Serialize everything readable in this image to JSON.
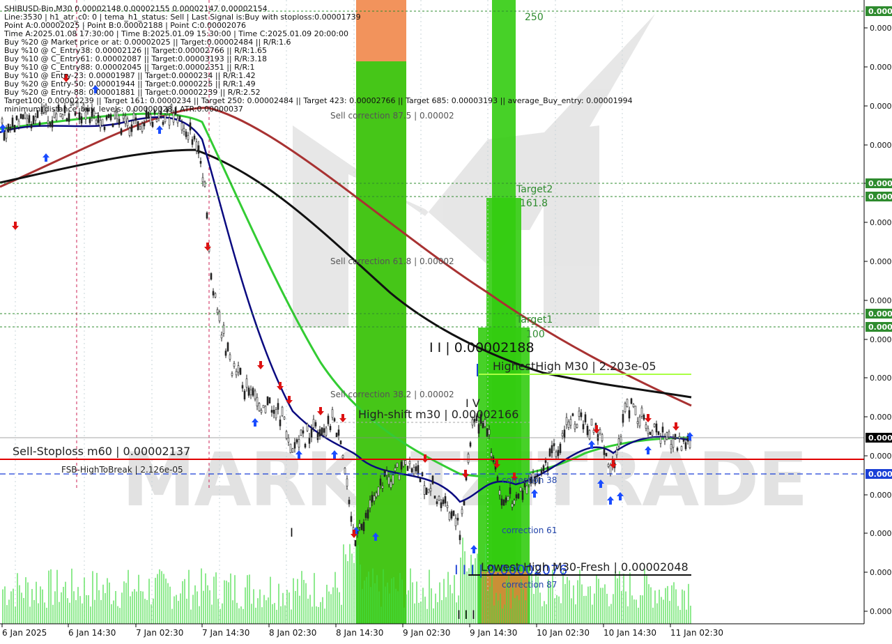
{
  "chart_data": {
    "type": "candlestick",
    "symbol_line": "SHIBUSD-Bin,M30  0.00002148 0.00002155 0.00002147 0.00002154",
    "info_lines": [
      "Line:3530 | h1_atr_c0: 0 | tema_h1_status: Sell | Last Signal is:Buy with stoploss:0.00001739",
      "Point A:0.00002025 | Point B:0.00002188 | Point C:0.00002076",
      "Time A:2025.01.08 17:30:00 | Time B:2025.01.09 15:30:00 | Time C:2025.01.09 20:00:00",
      "Buy %20 @ Market price or at: 0.00002025 || Target:0.00002484 || R/R:1.6",
      "Buy %10 @ C_Entry38: 0.00002126 || Target:0.00002766 || R/R:1.65",
      "Buy %10 @ C_Entry61: 0.00002087 || Target:0.00003193 || R/R:3.18",
      "Buy %10 @ C_Entry88: 0.00002045 || Target:0.00002351 || R/R:1",
      "Buy %10 @ Entry-23: 0.00001987 || Target:0.0000234 || R/R:1.42",
      "Buy %20 @ Entry-50: 0.00001944 || Target:0.0000225 || R/R:1.49",
      "Buy %20 @ Entry-88: 0.00001881 || Target:0.00002239 || R/R:2.52",
      "Target100: 0.00002239 || Target 161: 0.0000234 || Target 250: 0.00002484 || Target 423: 0.00002766 || Target 685: 0.00003193 || average_Buy_entry: 0.00001994",
      "minimum_distance_buy_levels: 0.00000028 | ATR:0.00000037"
    ],
    "x_tick_labels": [
      "6 Jan 2025",
      "6 Jan 14:30",
      "7 Jan 02:30",
      "7 Jan 14:30",
      "8 Jan 02:30",
      "8 Jan 14:30",
      "9 Jan 02:30",
      "9 Jan 14:30",
      "10 Jan 02:30",
      "10 Jan 14:30",
      "11 Jan 02:30"
    ],
    "y_tick_labels": [
      "0.0000",
      "0.0000",
      "0.0000",
      "0.0000",
      "0.0000",
      "0.0000",
      "0.0000",
      "0.0000",
      "0.0000",
      "0.0000",
      "0.0000",
      "0.0000",
      "0.0000",
      "0.0000",
      "0.0000",
      "0.0000"
    ],
    "price_tags": [
      {
        "label": "0.0000",
        "color": "#2e8b2e"
      },
      {
        "label": "0.0000",
        "color": "#2e8b2e"
      },
      {
        "label": "0.0000",
        "color": "#2e8b2e"
      },
      {
        "label": "0.0000",
        "color": "#2e8b2e"
      },
      {
        "label": "0.0000",
        "color": "#2e8b2e"
      },
      {
        "label": "0.0000",
        "color": "#000000"
      },
      {
        "label": "0.0000",
        "color": "#1a3fd6"
      }
    ],
    "annotations": {
      "fib_250": "250",
      "target2": "Target2",
      "fib_161": "161.8",
      "target1": "Target1",
      "fib_100": "100",
      "sell_corr_875": "Sell correction 87.5 | 0.00002",
      "sell_corr_618": "Sell correction 61.8 | 0.00002",
      "sell_corr_382": "Sell correction 38.2 | 0.00002",
      "point_b": "I I | 0.00002188",
      "highest_high": "HighestHigh   M30 | 2.203e-05",
      "iv_label": "I V",
      "high_shift": "High-shift m30 | 0.00002166",
      "sell_stoploss": "Sell-Stoploss m60 | 0.00002137",
      "fsb": "FSB-HighToBreak | 2.126e-05",
      "correction_38": "correction 38",
      "correction_61": "correction 61",
      "correction_87": "correction 87",
      "point_c": "I I I | 0.00002076",
      "lowest_high": "0.00002076",
      "lowest_fresh": "Lowest High   M30-Fresh | 0.00002048",
      "point_a": "I I I",
      "i_mark": "I",
      "watermark": "MARKETZITRADE"
    },
    "colors": {
      "ema_red": "#a83232",
      "ema_black": "#111111",
      "ema_green": "#33cc33",
      "ema_navy": "#0a0a80",
      "fib_green": "#33cc11",
      "fib_orange": "#f08040",
      "stoploss_red": "#e00000",
      "fsb_blue": "#1a3fd6",
      "buy_arrow": "#1a4cff",
      "sell_arrow": "#dd1111",
      "volume": "#44dd44"
    }
  }
}
